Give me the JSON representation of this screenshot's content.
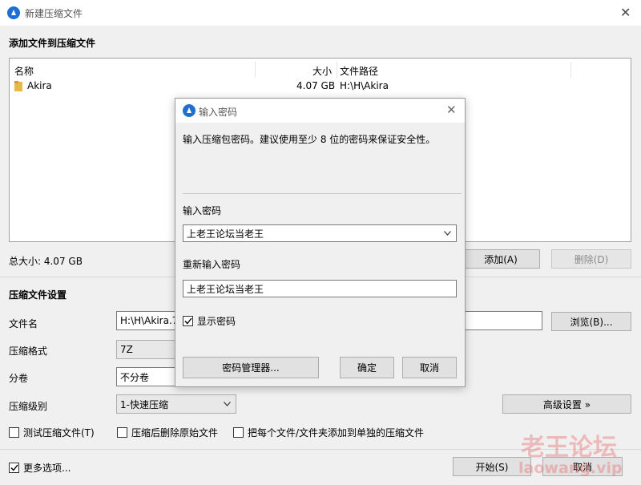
{
  "window": {
    "title": "新建压缩文件"
  },
  "add_section": {
    "title": "添加文件到压缩文件"
  },
  "file_list": {
    "columns": {
      "name": "名称",
      "size": "大小",
      "path": "文件路径"
    },
    "rows": [
      {
        "name": "Akira",
        "size": "4.07 GB",
        "path": "H:\\H\\Akira"
      }
    ]
  },
  "total_size": "总大小: 4.07 GB",
  "buttons": {
    "add": "添加(A)",
    "remove": "删除(D)",
    "browse": "浏览(B)...",
    "advanced": "高级设置 »",
    "start": "开始(S)",
    "cancel": "取消"
  },
  "settings": {
    "title": "压缩文件设置",
    "filename_label": "文件名",
    "filename_value": "H:\\H\\Akira.7",
    "format_label": "压缩格式",
    "format_value": "7Z",
    "split_label": "分卷",
    "split_value": "不分卷",
    "level_label": "压缩级别",
    "level_value": "1-快速压缩"
  },
  "options": {
    "test": "测试压缩文件(T)",
    "delete_after": "压缩后删除原始文件",
    "separate": "把每个文件/文件夹添加到单独的压缩文件",
    "more": "更多选项..."
  },
  "dialog": {
    "title": "输入密码",
    "message": "输入压缩包密码。建议使用至少 8 位的密码来保证安全性。",
    "password_label": "输入密码",
    "password_value": "上老王论坛当老王",
    "confirm_label": "重新输入密码",
    "confirm_value": "上老王论坛当老王",
    "show_password": "显示密码",
    "manager_button": "密码管理器...",
    "ok_button": "确定",
    "cancel_button": "取消"
  },
  "watermark": {
    "line1": "老王论坛",
    "line2": "laowang.vip"
  },
  "colors": {
    "accent": "#1e6fd0",
    "folder": "#e8b84a"
  }
}
